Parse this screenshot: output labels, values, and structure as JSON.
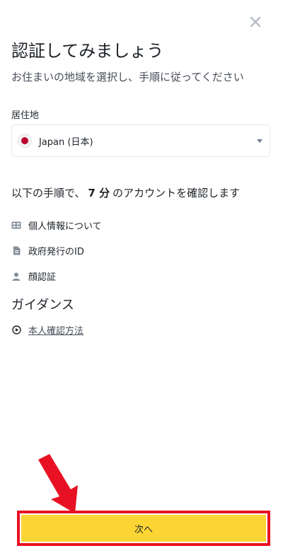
{
  "header": {
    "title": "認証してみましょう",
    "subtitle": "お住まいの地域を選択し、手順に従ってください",
    "close_icon": "close-icon"
  },
  "residence": {
    "label": "居住地",
    "selected_value": "Japan (日本)",
    "flag_icon": "japan-flag-icon"
  },
  "steps": {
    "intro_prefix": "以下の手順で、",
    "minutes": "7 分",
    "intro_suffix": "のアカウントを確認します",
    "items": [
      {
        "label": "個人情報について",
        "icon": "id-card-icon"
      },
      {
        "label": "政府発行のID",
        "icon": "document-icon"
      },
      {
        "label": "顔認証",
        "icon": "person-icon"
      }
    ]
  },
  "guidance": {
    "heading": "ガイダンス",
    "link_label": "本人確認方法",
    "link_icon": "play-circle-icon"
  },
  "footer": {
    "next_label": "次へ"
  },
  "colors": {
    "accent": "#fcd535",
    "highlight": "#e81123",
    "flag_red": "#bc002d"
  }
}
